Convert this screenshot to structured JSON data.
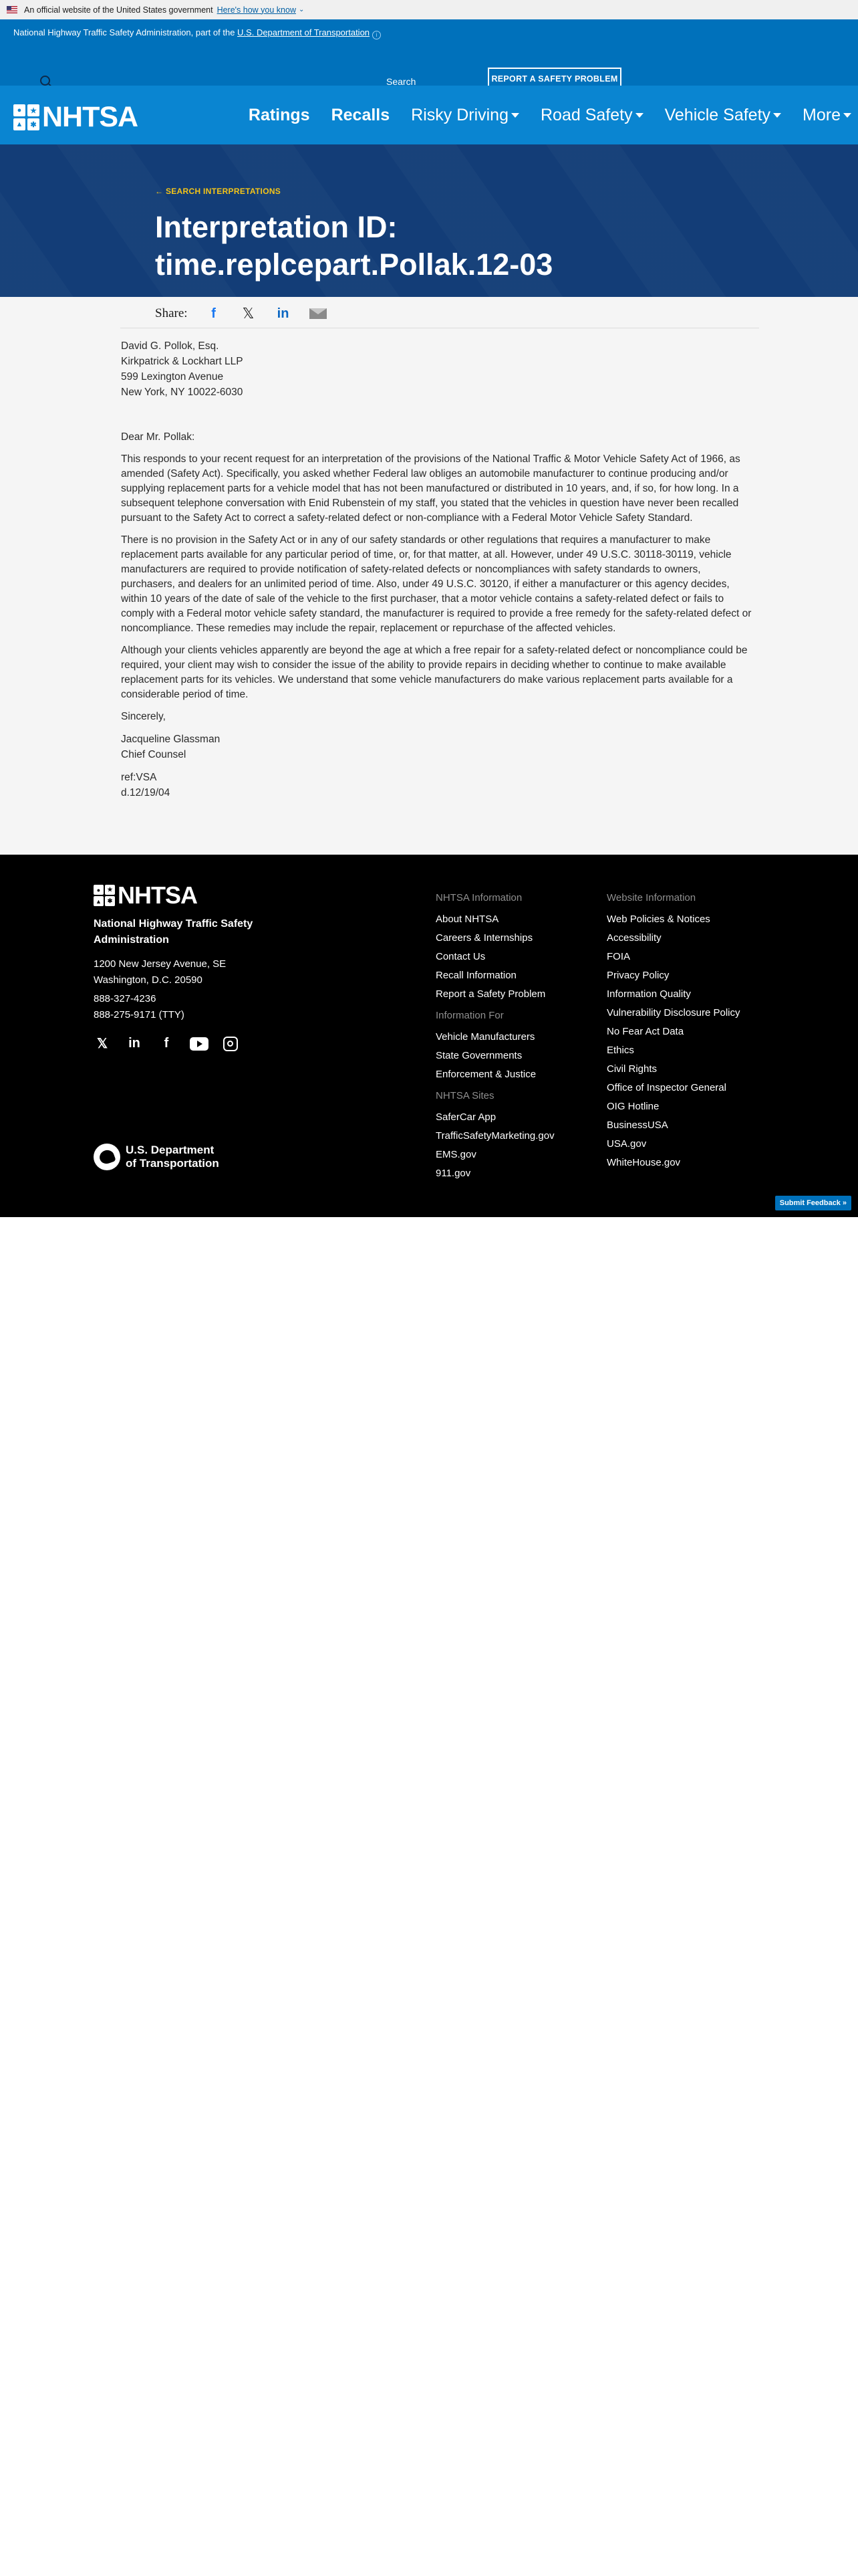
{
  "gov_banner": {
    "text": "An official website of the United States government",
    "link": "Here's how you know"
  },
  "utility": {
    "parent_prefix": "National Highway Traffic Safety Administration, part of the ",
    "parent_link": "U.S. Department of Transportation",
    "search_label": "Search",
    "report_button": "REPORT A SAFETY PROBLEM"
  },
  "nav": {
    "logo_text": "NHTSA",
    "items": [
      {
        "label": "Ratings"
      },
      {
        "label": "Recalls"
      },
      {
        "label": "Risky Driving"
      },
      {
        "label": "Road Safety"
      },
      {
        "label": "Vehicle Safety"
      },
      {
        "label": "More"
      }
    ]
  },
  "hero": {
    "back_link": "SEARCH INTERPRETATIONS",
    "title_line1": "Interpretation ID:",
    "title_line2": "time.replcepart.Pollak.12-03"
  },
  "share": {
    "label": "Share:"
  },
  "letter": {
    "address": [
      "David G. Pollok, Esq.",
      "Kirkpatrick & Lockhart LLP",
      "599 Lexington Avenue",
      "New York, NY 10022-6030"
    ],
    "salutation": "Dear Mr. Pollak:",
    "paragraphs": [
      "This responds to your recent request for an interpretation of the provisions of the National Traffic & Motor Vehicle Safety Act of 1966, as amended (Safety Act). Specifically, you asked whether Federal law obliges an automobile manufacturer to continue producing and/or supplying replacement parts for a vehicle model that has not been manufactured or distributed in 10 years, and, if so, for how long. In a subsequent telephone conversation with Enid Rubenstein of my staff, you stated that the vehicles in question have never been recalled pursuant to the Safety Act to correct a safety-related defect or non-compliance with a Federal Motor Vehicle Safety Standard.",
      "There is no provision in the Safety Act or in any of our safety standards or other regulations that requires a manufacturer to make replacement parts available for any particular period of time, or, for that matter, at all. However, under 49 U.S.C. 30118-30119, vehicle manufacturers are required to provide notification of safety-related defects or noncompliances with safety standards to owners, purchasers, and dealers for an unlimited period of time. Also, under 49 U.S.C. 30120, if either a manufacturer or this agency decides, within 10 years of the date of sale of the vehicle to the first purchaser, that a motor vehicle contains a safety-related defect or fails to comply with a Federal motor vehicle safety standard, the manufacturer is required to provide a free remedy for the safety-related defect or noncompliance. These remedies may include the repair, replacement or repurchase of the affected vehicles.",
      "Although your clients vehicles apparently are beyond the age at which a free repair for a safety-related defect or noncompliance could be required, your client may wish to consider the issue of the ability to provide repairs in deciding whether to continue to make available replacement parts for its vehicles. We understand that some vehicle manufacturers do make various replacement parts available for a considerable period of time."
    ],
    "closing": "Sincerely,",
    "signer_name": "Jacqueline Glassman",
    "signer_title": "Chief Counsel",
    "ref": "ref:VSA",
    "date": "d.12/19/04"
  },
  "footer": {
    "logo_text": "NHTSA",
    "agency": "National Highway Traffic Safety Administration",
    "address_line1": "1200 New Jersey Avenue, SE",
    "address_line2": "Washington, D.C. 20590",
    "phone1": "888-327-4236",
    "phone2": "888-275-9171 (TTY)",
    "dot_line1": "U.S. Department",
    "dot_line2": "of Transportation",
    "col1": {
      "info_head": "NHTSA Information",
      "info_links": [
        "About NHTSA",
        "Careers & Internships",
        "Contact Us",
        "Recall Information",
        "Report a Safety Problem"
      ],
      "for_head": "Information For",
      "for_links": [
        "Vehicle Manufacturers",
        "State Governments",
        "Enforcement & Justice"
      ],
      "sites_head": "NHTSA Sites",
      "sites_links": [
        "SaferCar App",
        "TrafficSafetyMarketing.gov",
        "EMS.gov",
        "911.gov"
      ]
    },
    "col2": {
      "head": "Website Information",
      "links": [
        "Web Policies & Notices",
        "Accessibility",
        "FOIA",
        "Privacy Policy",
        "Information Quality",
        "Vulnerability Disclosure Policy",
        "No Fear Act Data",
        "Ethics",
        "Civil Rights",
        "Office of Inspector General",
        "OIG Hotline",
        "BusinessUSA",
        "USA.gov",
        "WhiteHouse.gov"
      ]
    },
    "feedback_button": "Submit Feedback »"
  }
}
